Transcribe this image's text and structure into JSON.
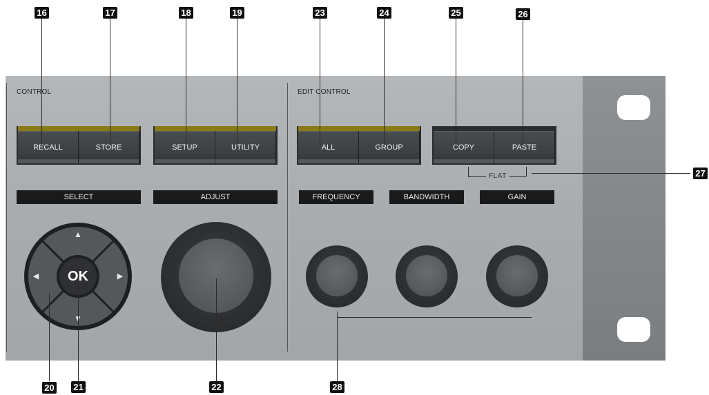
{
  "sections": {
    "control": "CONTROL",
    "edit_control": "EDIT CONTROL"
  },
  "buttons": {
    "recall": "RECALL",
    "store": "STORE",
    "setup": "SETUP",
    "utility": "UTILITY",
    "all": "ALL",
    "group": "GROUP",
    "copy": "COPY",
    "paste": "PASTE"
  },
  "labels": {
    "select": "SELECT",
    "adjust": "ADJUST",
    "frequency": "FREQUENCY",
    "bandwidth": "BANDWIDTH",
    "gain": "GAIN",
    "flat": "FLAT"
  },
  "dpad": {
    "ok": "OK",
    "up": "▲",
    "down": "▼",
    "left": "◀",
    "right": "▶"
  },
  "callouts": {
    "c16": "16",
    "c17": "17",
    "c18": "18",
    "c19": "19",
    "c20": "20",
    "c21": "21",
    "c22": "22",
    "c23": "23",
    "c24": "24",
    "c25": "25",
    "c26": "26",
    "c27": "27",
    "c28": "28"
  },
  "colors": {
    "panel": "#a9adb0",
    "indicator": "#8a7a14",
    "button": "#3c3f42",
    "label_bar": "#1a1a1a"
  }
}
